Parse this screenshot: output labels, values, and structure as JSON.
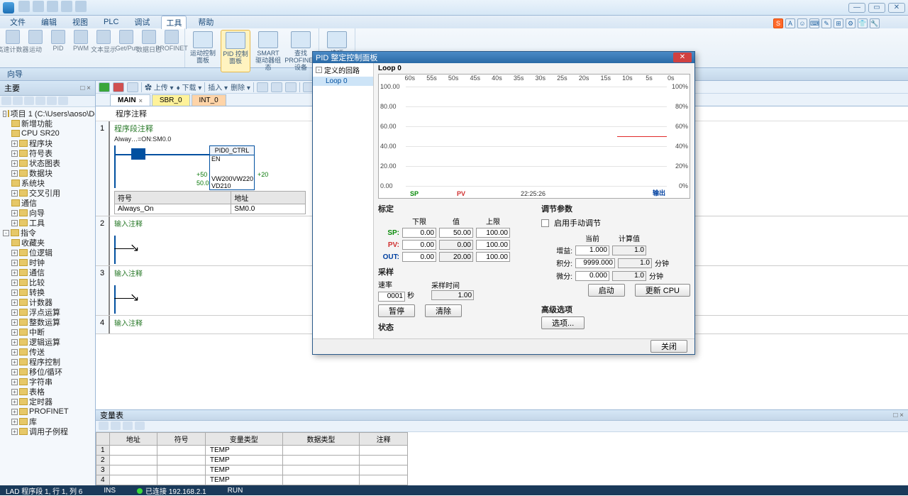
{
  "titlebar": {
    "min": "—",
    "max": "▭",
    "close": "✕"
  },
  "menu": {
    "file": "文件",
    "edit": "编辑",
    "view": "视图",
    "plc": "PLC",
    "debug": "调试",
    "tools": "工具",
    "help": "帮助"
  },
  "ribbon": {
    "grp1": {
      "items": [
        "高速计数器",
        "运动",
        "PID",
        "PWM",
        "文本显示",
        "Get/Put",
        "数据日志",
        "PROFINET"
      ]
    },
    "grp2": {
      "a": "运动控制面板",
      "b": "PID\n控制面板",
      "c": "SMART\n驱动器组态",
      "d": "查找\nPROFINET设备"
    },
    "grp3": {
      "opt": "选项"
    }
  },
  "subband": "向导",
  "leftpanel": {
    "title": "主要",
    "tabx": "□ ×"
  },
  "tree": {
    "project": "项目 1 (C:\\Users\\aoso\\Desktop\\",
    "newfunc": "新增功能",
    "cpu": "CPU SR20",
    "progblk": "程序块",
    "symtab": "符号表",
    "statchart": "状态图表",
    "datablk": "数据块",
    "sysblk": "系统块",
    "crossref": "交叉引用",
    "comm": "通信",
    "wizards": "向导",
    "tools": "工具",
    "instr": "指令",
    "fav": "收藏夹",
    "bitlogic": "位逻辑",
    "clock": "时钟",
    "comm2": "通信",
    "compare": "比较",
    "convert": "转换",
    "counters": "计数器",
    "float": "浮点运算",
    "int": "整数运算",
    "interrupt": "中断",
    "logic": "逻辑运算",
    "move": "传送",
    "progctrl": "程序控制",
    "shift": "移位/循环",
    "string": "字符串",
    "table": "表格",
    "timers": "定时器",
    "profinet": "PROFINET",
    "libs": "库",
    "callsub": "调用子例程"
  },
  "tabs": {
    "main": "MAIN",
    "sbr": "SBR_0",
    "int": "INT_0"
  },
  "editor": {
    "header": "程序注释",
    "net1": {
      "comment": "程序段注释",
      "contact": "Alway…=ON:SM0.0",
      "fb": "PID0_CTRL",
      "en": "EN",
      "in1l": "+50",
      "in1": "VW200",
      "out1": "VW220",
      "out1r": "+20",
      "in2l": "50.0",
      "in2": "VD210",
      "sym_h1": "符号",
      "sym_h2": "地址",
      "sym_r1c1": "Always_On",
      "sym_r1c2": "SM0.0"
    },
    "net2c": "输入注释",
    "net3c": "输入注释",
    "net4c": "输入注释"
  },
  "vartable": {
    "title": "变量表",
    "h": {
      "addr": "地址",
      "sym": "符号",
      "vartype": "变量类型",
      "datatype": "数据类型",
      "comment": "注释"
    },
    "temp": "TEMP"
  },
  "status": {
    "pos": "LAD 程序段 1, 行 1, 列 6",
    "ins": "INS",
    "conn": "已连接 192.168.2.1",
    "run": "RUN"
  },
  "dialog": {
    "title": "PID 整定控制面板",
    "loops_hdr": "定义的回路",
    "loop0": "Loop 0",
    "chart": {
      "x": [
        "60s",
        "55s",
        "50s",
        "45s",
        "40s",
        "35s",
        "30s",
        "25s",
        "20s",
        "15s",
        "10s",
        "5s",
        "0s"
      ],
      "yl": [
        "100.00",
        "80.00",
        "60.00",
        "40.00",
        "20.00",
        "0.00"
      ],
      "yr": [
        "100%",
        "80%",
        "60%",
        "40%",
        "20%",
        "0%"
      ],
      "sp": "SP",
      "pv": "PV",
      "time": "22:25:26",
      "out": "输出"
    },
    "scaling": {
      "title": "标定",
      "lower": "下限",
      "value": "值",
      "upper": "上限",
      "sp": "SP:",
      "pv": "PV:",
      "out": "OUT:",
      "sp_l": "0.00",
      "sp_v": "50.00",
      "sp_u": "100.00",
      "pv_l": "0.00",
      "pv_v": "0.00",
      "pv_u": "100.00",
      "out_l": "0.00",
      "out_v": "20.00",
      "out_u": "100.00"
    },
    "sampling": {
      "title": "采样",
      "rate": "速率",
      "val": "0001",
      "unit": "秒",
      "timelbl": "采样时间",
      "time": "1.00",
      "pause": "暂停",
      "clear": "清除"
    },
    "status": "状态",
    "tune": {
      "title": "调节参数",
      "manual": "启用手动调节",
      "cur": "当前",
      "calc": "计算值",
      "gain": "增益:",
      "gain_c": "1.000",
      "gain_v": "1.0",
      "integ": "积分:",
      "integ_c": "9999.000",
      "integ_v": "1.0",
      "unit_min": "分钟",
      "deriv": "微分:",
      "deriv_c": "0.000",
      "deriv_v": "1.0",
      "start": "启动",
      "update": "更新 CPU"
    },
    "adv": {
      "title": "高级选项",
      "btn": "选项..."
    },
    "close": "关闭"
  },
  "righttools": {
    "s": "S"
  },
  "chart_data": {
    "type": "line",
    "title": "Loop 0",
    "x_seconds": [
      60,
      55,
      50,
      45,
      40,
      35,
      30,
      25,
      20,
      15,
      10,
      5,
      0
    ],
    "ylim_left": [
      0,
      100
    ],
    "ylim_right_percent": [
      0,
      100
    ],
    "series": [
      {
        "name": "SP",
        "color": "#0a8a0a",
        "values": []
      },
      {
        "name": "PV",
        "color": "#d03030",
        "values_approx": [
          {
            "t_from": 18,
            "t_to": 0,
            "y": 50
          }
        ]
      },
      {
        "name": "输出",
        "color": "#0040a0",
        "values": []
      }
    ],
    "timestamp": "22:25:26"
  }
}
